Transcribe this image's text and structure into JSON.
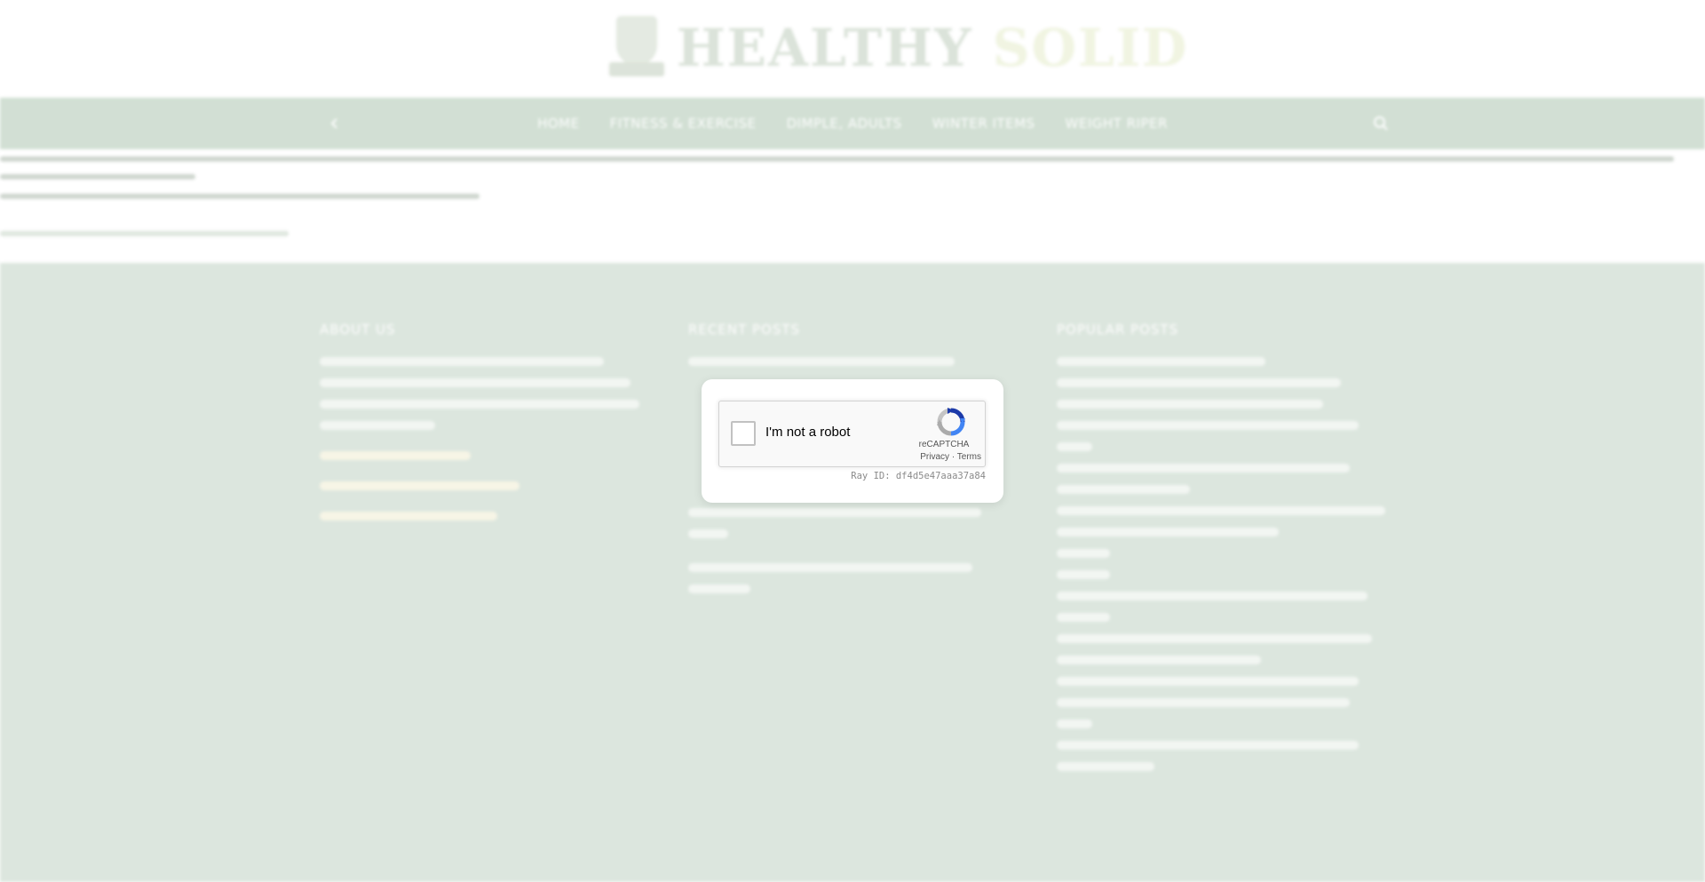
{
  "site": {
    "logo": {
      "word1": "HEALTHY",
      "word2": "SOLID"
    },
    "nav": {
      "items": [
        "HOME",
        "FITNESS & EXERCISE",
        "DIMPLE, ADULTS",
        "WINTER ITEMS",
        "WEIGHT RIPER"
      ]
    },
    "footer": {
      "headings": [
        "ABOUT US",
        "RECENT POSTS",
        "POPULAR POSTS"
      ]
    }
  },
  "captcha": {
    "label": "I'm not a robot",
    "brand": "reCAPTCHA",
    "privacy": "Privacy",
    "separator": " · ",
    "terms": "Terms",
    "ray_id": "Ray ID: df4d5e47aaa37a84"
  }
}
